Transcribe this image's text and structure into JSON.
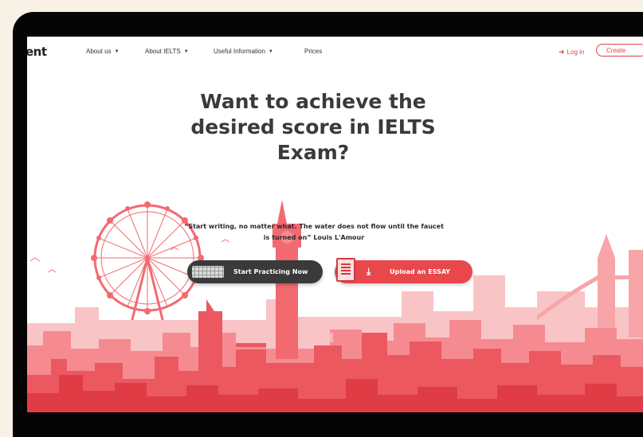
{
  "nav": {
    "logo_text": "ent",
    "items": [
      {
        "label": "About us",
        "has_caret": true
      },
      {
        "label": "About IELTS",
        "has_caret": true
      },
      {
        "label": "Useful Information",
        "has_caret": true
      },
      {
        "label": "Prices",
        "has_caret": false
      }
    ],
    "login_label": "Log in",
    "create_label": "Create"
  },
  "hero": {
    "headline_lines": [
      "Want to achieve the",
      "desired score in IELTS",
      "Exam?"
    ],
    "quote_line1": "“Start writing, no matter what. The water does not flow until the faucet",
    "quote_line2": "is turned on” Louis L'Amour",
    "practice_button": "Start Practicing Now",
    "upload_button": "Upload an ESSAY"
  },
  "icons": {
    "caret": "caret-down-icon",
    "login": "login-icon",
    "keyboard": "keyboard-icon",
    "document": "document-icon",
    "upload": "upload-icon"
  },
  "colors": {
    "accent": "#e8474c",
    "skyline_dark": "#e03c45",
    "skyline_mid": "#f07278",
    "skyline_light": "#f7a5a8",
    "text_dark": "#3a3a3a",
    "page_bg": "#f8f1e6",
    "device": "#050505"
  }
}
